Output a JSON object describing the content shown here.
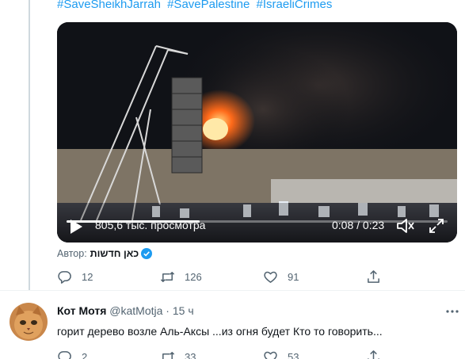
{
  "tweet": {
    "hashtags": [
      "#SaveSheikhJarrah",
      "#SavePalestine",
      "#IsraeliCrimes"
    ],
    "video": {
      "views": "805,6 тыс. просмотра",
      "time": "0:08 / 0:23",
      "progress_fraction": 0.35
    },
    "author_label": "Автор:",
    "author_name": "כאן חדשות",
    "actions": {
      "reply_count": "12",
      "retweet_count": "126",
      "like_count": "91"
    }
  },
  "reply": {
    "display_name": "Кот Мотя",
    "handle": "@katMotja",
    "separator": "·",
    "time": "15 ч",
    "text": "горит дерево возле Аль-Аксы ...из огня будет Кто то говорить...",
    "actions": {
      "reply_count": "2",
      "retweet_count": "33",
      "like_count": "53"
    }
  },
  "colors": {
    "accent": "#1d9bf0",
    "secondary_text": "#536471",
    "fire": "#ff6a1a"
  }
}
